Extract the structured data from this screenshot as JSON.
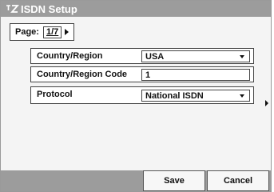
{
  "window": {
    "title": "ISDN Setup",
    "title_icon": "isdn-logo-icon"
  },
  "page_selector": {
    "label": "Page:",
    "value": "1/7"
  },
  "form": {
    "rows": [
      {
        "label": "Country/Region",
        "value": "USA",
        "type": "dropdown"
      },
      {
        "label": "Country/Region Code",
        "value": "1",
        "type": "text"
      },
      {
        "label": "Protocol",
        "value": "National ISDN",
        "type": "dropdown"
      }
    ]
  },
  "footer": {
    "save_label": "Save",
    "cancel_label": "Cancel"
  }
}
